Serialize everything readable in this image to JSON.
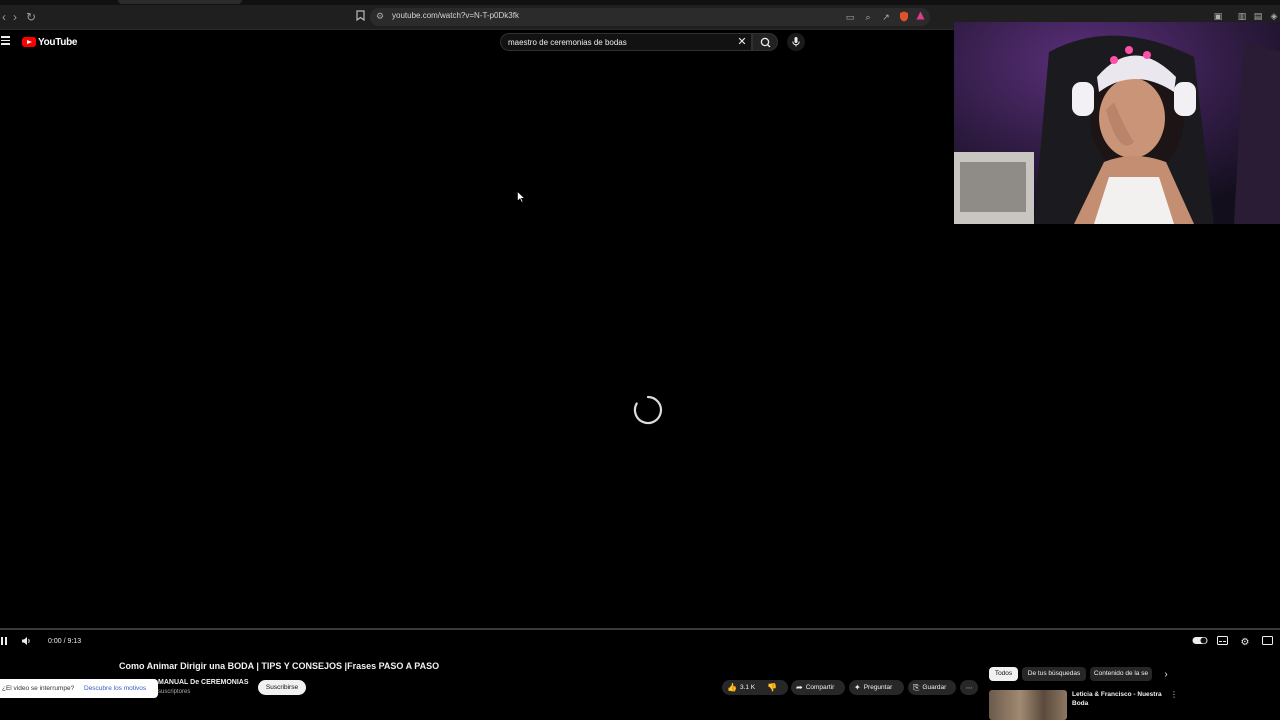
{
  "browser": {
    "url": "youtube.com/watch?v=N-T-p0Dk3fk",
    "nav_icons": [
      "back-icon",
      "forward-icon",
      "reload-icon"
    ]
  },
  "masthead": {
    "logo_text": "YouTube",
    "search_value": "maestro de ceremonias de bodas"
  },
  "player": {
    "time_current": "0:00",
    "time_total": "9:13",
    "timecode": "0:00 / 9:13",
    "progress_fraction": 0
  },
  "video": {
    "title": "Como Animar Dirigir una BODA | TIPS Y CONSEJOS |Frases PASO A PASO",
    "channel_name": "MANUAL De CEREMONIAS",
    "channel_subs": "suscriptores",
    "subscribe_label": "Suscribirse",
    "interrupt_question": "¿El video se interrumpe?",
    "interrupt_link": "Descubre los motivos",
    "actions": {
      "like_count": "3.1 K",
      "share_label": "Compartir",
      "ask_label": "Preguntar",
      "save_label": "Guardar"
    }
  },
  "right_rail": {
    "chips": [
      "Todos",
      "De tus búsquedas",
      "Contenido de la se"
    ],
    "rec_title": "Leticia & Francisco - Nuestra Boda"
  },
  "colors": {
    "yt_red": "#ff0000",
    "background": "#000000",
    "pill": "#272727"
  }
}
